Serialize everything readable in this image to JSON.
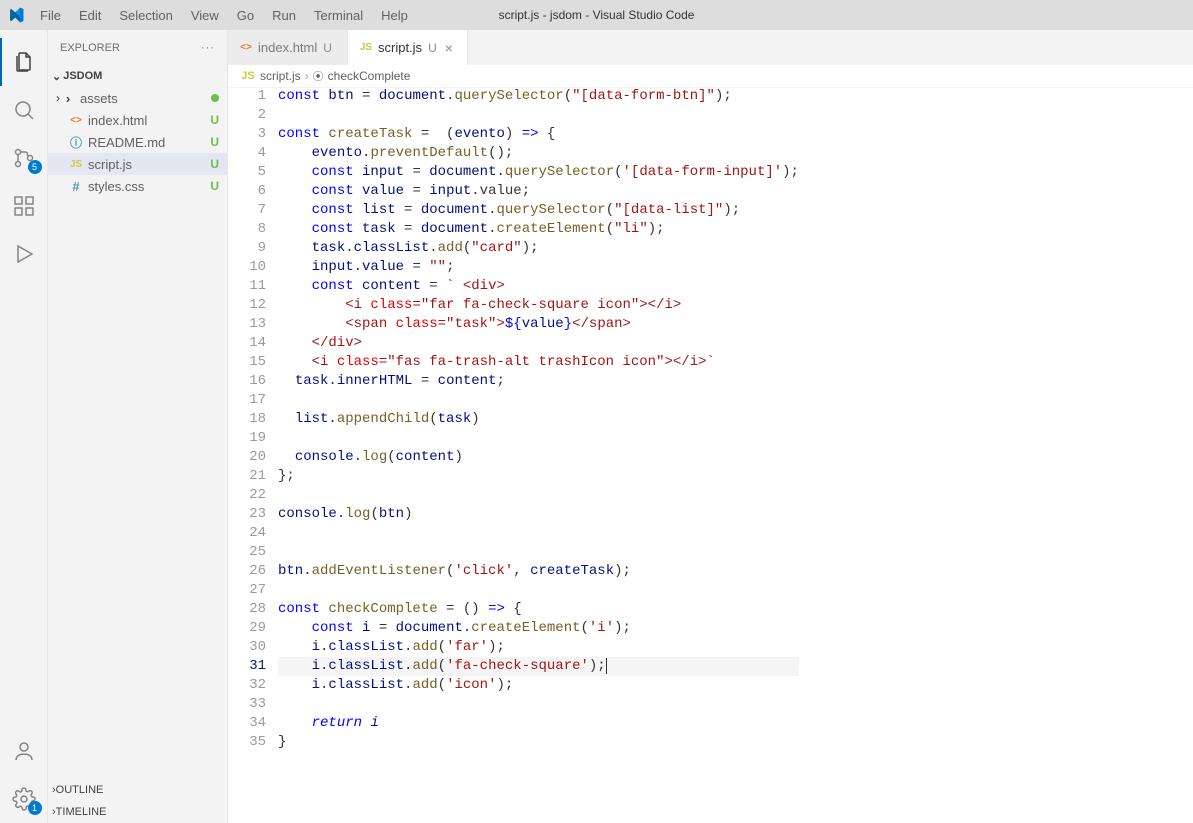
{
  "titlebar": {
    "menus": [
      "File",
      "Edit",
      "Selection",
      "View",
      "Go",
      "Run",
      "Terminal",
      "Help"
    ],
    "title": "script.js - jsdom - Visual Studio Code"
  },
  "activitybar": {
    "scm_badge": "5",
    "settings_badge": "1"
  },
  "sidebar": {
    "title": "EXPLORER",
    "folder": "JSDOM",
    "files": [
      {
        "name": "assets",
        "type": "folder",
        "status": "modified"
      },
      {
        "name": "index.html",
        "type": "html",
        "status": "U"
      },
      {
        "name": "README.md",
        "type": "md",
        "status": "U"
      },
      {
        "name": "script.js",
        "type": "js",
        "status": "U",
        "selected": true
      },
      {
        "name": "styles.css",
        "type": "css",
        "status": "U"
      }
    ],
    "outline": "OUTLINE",
    "timeline": "TIMELINE"
  },
  "tabs": [
    {
      "label": "index.html",
      "type": "html",
      "mod": "U",
      "active": false
    },
    {
      "label": "script.js",
      "type": "js",
      "mod": "U",
      "active": true
    }
  ],
  "breadcrumbs": {
    "file_icon": "JS",
    "file": "script.js",
    "sym_icon": "⊕",
    "symbol": "checkComplete"
  },
  "code": {
    "current_line": 31,
    "lines": [
      {
        "n": 1,
        "tokens": [
          [
            "kw",
            "const"
          ],
          [
            "",
            " "
          ],
          [
            "var",
            "btn"
          ],
          [
            "",
            " "
          ],
          [
            "",
            "="
          ],
          [
            "",
            " "
          ],
          [
            "obj",
            "document"
          ],
          [
            "",
            "."
          ],
          [
            "fn",
            "querySelector"
          ],
          [
            "",
            "("
          ],
          [
            "str",
            "\"[data-form-btn]\""
          ],
          [
            "",
            ");"
          ]
        ]
      },
      {
        "n": 2,
        "tokens": []
      },
      {
        "n": 3,
        "tokens": [
          [
            "kw",
            "const"
          ],
          [
            "",
            " "
          ],
          [
            "fn",
            "createTask"
          ],
          [
            "",
            " "
          ],
          [
            "",
            "="
          ],
          [
            "",
            "  ("
          ],
          [
            "var",
            "evento"
          ],
          [
            "",
            ")"
          ],
          [
            "",
            " "
          ],
          [
            "kw",
            "=>"
          ],
          [
            "",
            " {"
          ]
        ]
      },
      {
        "n": 4,
        "tokens": [
          [
            "",
            "    "
          ],
          [
            "obj",
            "evento"
          ],
          [
            "",
            "."
          ],
          [
            "fn",
            "preventDefault"
          ],
          [
            "",
            "();"
          ]
        ]
      },
      {
        "n": 5,
        "tokens": [
          [
            "",
            "    "
          ],
          [
            "kw",
            "const"
          ],
          [
            "",
            " "
          ],
          [
            "var",
            "input"
          ],
          [
            "",
            " = "
          ],
          [
            "obj",
            "document"
          ],
          [
            "",
            "."
          ],
          [
            "fn",
            "querySelector"
          ],
          [
            "",
            "("
          ],
          [
            "str",
            "'[data-form-input]'"
          ],
          [
            "",
            ");"
          ]
        ]
      },
      {
        "n": 6,
        "tokens": [
          [
            "",
            "    "
          ],
          [
            "kw",
            "const"
          ],
          [
            "",
            " "
          ],
          [
            "var",
            "value"
          ],
          [
            "",
            " = "
          ],
          [
            "obj",
            "input"
          ],
          [
            "",
            ".value;"
          ]
        ]
      },
      {
        "n": 7,
        "tokens": [
          [
            "",
            "    "
          ],
          [
            "kw",
            "const"
          ],
          [
            "",
            " "
          ],
          [
            "var",
            "list"
          ],
          [
            "",
            " = "
          ],
          [
            "obj",
            "document"
          ],
          [
            "",
            "."
          ],
          [
            "fn",
            "querySelector"
          ],
          [
            "",
            "("
          ],
          [
            "str",
            "\"[data-list]\""
          ],
          [
            "",
            ");"
          ]
        ]
      },
      {
        "n": 8,
        "tokens": [
          [
            "",
            "    "
          ],
          [
            "kw",
            "const"
          ],
          [
            "",
            " "
          ],
          [
            "var",
            "task"
          ],
          [
            "",
            " = "
          ],
          [
            "obj",
            "document"
          ],
          [
            "",
            "."
          ],
          [
            "fn",
            "createElement"
          ],
          [
            "",
            "("
          ],
          [
            "str",
            "\"li\""
          ],
          [
            "",
            ");"
          ]
        ]
      },
      {
        "n": 9,
        "tokens": [
          [
            "",
            "    "
          ],
          [
            "obj",
            "task"
          ],
          [
            "",
            "."
          ],
          [
            "obj",
            "classList"
          ],
          [
            "",
            "."
          ],
          [
            "fn",
            "add"
          ],
          [
            "",
            "("
          ],
          [
            "str",
            "\"card\""
          ],
          [
            "",
            ");"
          ]
        ]
      },
      {
        "n": 10,
        "tokens": [
          [
            "",
            "    "
          ],
          [
            "obj",
            "input"
          ],
          [
            "",
            "."
          ],
          [
            "obj",
            "value"
          ],
          [
            "",
            " = "
          ],
          [
            "str",
            "\"\""
          ],
          [
            "",
            ";"
          ]
        ]
      },
      {
        "n": 11,
        "tokens": [
          [
            "",
            "    "
          ],
          [
            "kw",
            "const"
          ],
          [
            "",
            " "
          ],
          [
            "var",
            "content"
          ],
          [
            "",
            " = "
          ],
          [
            "templ",
            "` <div>"
          ]
        ]
      },
      {
        "n": 12,
        "tokens": [
          [
            "templ",
            "        <i "
          ],
          [
            "attr",
            "class"
          ],
          [
            "templ",
            "="
          ],
          [
            "str",
            "\"far fa-check-square icon\""
          ],
          [
            "templ",
            "></i>"
          ]
        ]
      },
      {
        "n": 13,
        "tokens": [
          [
            "templ",
            "        <span "
          ],
          [
            "attr",
            "class"
          ],
          [
            "templ",
            "="
          ],
          [
            "str",
            "\"task\""
          ],
          [
            "templ",
            ">"
          ],
          [
            "kw",
            "${"
          ],
          [
            "var",
            "value"
          ],
          [
            "kw",
            "}"
          ],
          [
            "templ",
            "</span>"
          ]
        ]
      },
      {
        "n": 14,
        "tokens": [
          [
            "templ",
            "    </div>"
          ]
        ]
      },
      {
        "n": 15,
        "tokens": [
          [
            "templ",
            "    <i "
          ],
          [
            "attr",
            "class"
          ],
          [
            "templ",
            "="
          ],
          [
            "str",
            "\"fas fa-trash-alt trashIcon icon\""
          ],
          [
            "templ",
            "></i>`"
          ]
        ]
      },
      {
        "n": 16,
        "tokens": [
          [
            "",
            "  "
          ],
          [
            "obj",
            "task"
          ],
          [
            "",
            "."
          ],
          [
            "obj",
            "innerHTML"
          ],
          [
            "",
            " = "
          ],
          [
            "var",
            "content"
          ],
          [
            "",
            ";"
          ]
        ]
      },
      {
        "n": 17,
        "tokens": []
      },
      {
        "n": 18,
        "tokens": [
          [
            "",
            "  "
          ],
          [
            "obj",
            "list"
          ],
          [
            "",
            "."
          ],
          [
            "fn",
            "appendChild"
          ],
          [
            "",
            "("
          ],
          [
            "var",
            "task"
          ],
          [
            "",
            ")"
          ]
        ]
      },
      {
        "n": 19,
        "tokens": []
      },
      {
        "n": 20,
        "tokens": [
          [
            "",
            "  "
          ],
          [
            "obj",
            "console"
          ],
          [
            "",
            "."
          ],
          [
            "fn",
            "log"
          ],
          [
            "",
            "("
          ],
          [
            "var",
            "content"
          ],
          [
            "",
            ")"
          ]
        ]
      },
      {
        "n": 21,
        "tokens": [
          [
            "",
            "};"
          ]
        ]
      },
      {
        "n": 22,
        "tokens": []
      },
      {
        "n": 23,
        "tokens": [
          [
            "obj",
            "console"
          ],
          [
            "",
            "."
          ],
          [
            "fn",
            "log"
          ],
          [
            "",
            "("
          ],
          [
            "var",
            "btn"
          ],
          [
            "",
            ")"
          ]
        ]
      },
      {
        "n": 24,
        "tokens": []
      },
      {
        "n": 25,
        "tokens": []
      },
      {
        "n": 26,
        "tokens": [
          [
            "obj",
            "btn"
          ],
          [
            "",
            "."
          ],
          [
            "fn",
            "addEventListener"
          ],
          [
            "",
            "("
          ],
          [
            "str",
            "'click'"
          ],
          [
            "",
            ", "
          ],
          [
            "var",
            "createTask"
          ],
          [
            "",
            ");"
          ]
        ]
      },
      {
        "n": 27,
        "tokens": []
      },
      {
        "n": 28,
        "tokens": [
          [
            "kw",
            "const"
          ],
          [
            "",
            " "
          ],
          [
            "fn",
            "checkComplete"
          ],
          [
            "",
            " = () "
          ],
          [
            "kw",
            "=>"
          ],
          [
            "",
            " {"
          ]
        ]
      },
      {
        "n": 29,
        "tokens": [
          [
            "",
            "    "
          ],
          [
            "kw",
            "const"
          ],
          [
            "",
            " "
          ],
          [
            "var",
            "i"
          ],
          [
            "",
            " = "
          ],
          [
            "obj",
            "document"
          ],
          [
            "",
            "."
          ],
          [
            "fn",
            "createElement"
          ],
          [
            "",
            "("
          ],
          [
            "str",
            "'i'"
          ],
          [
            "",
            ");"
          ]
        ]
      },
      {
        "n": 30,
        "tokens": [
          [
            "",
            "    "
          ],
          [
            "obj",
            "i"
          ],
          [
            "",
            "."
          ],
          [
            "obj",
            "classList"
          ],
          [
            "",
            "."
          ],
          [
            "fn",
            "add"
          ],
          [
            "",
            "("
          ],
          [
            "str",
            "'far'"
          ],
          [
            "",
            ");"
          ]
        ]
      },
      {
        "n": 31,
        "tokens": [
          [
            "",
            "    "
          ],
          [
            "obj",
            "i"
          ],
          [
            "",
            "."
          ],
          [
            "obj",
            "classList"
          ],
          [
            "",
            "."
          ],
          [
            "fn",
            "add"
          ],
          [
            "",
            "("
          ],
          [
            "str",
            "'fa-check-square'"
          ],
          [
            "",
            ");"
          ]
        ]
      },
      {
        "n": 32,
        "tokens": [
          [
            "",
            "    "
          ],
          [
            "obj",
            "i"
          ],
          [
            "",
            "."
          ],
          [
            "obj",
            "classList"
          ],
          [
            "",
            "."
          ],
          [
            "fn",
            "add"
          ],
          [
            "",
            "("
          ],
          [
            "str",
            "'icon'"
          ],
          [
            "",
            ");"
          ]
        ]
      },
      {
        "n": 33,
        "tokens": []
      },
      {
        "n": 34,
        "tokens": [
          [
            "",
            "    "
          ],
          [
            "kw it",
            "return"
          ],
          [
            "",
            " "
          ],
          [
            "var it",
            "i"
          ]
        ]
      },
      {
        "n": 35,
        "tokens": [
          [
            "",
            "}"
          ]
        ]
      }
    ]
  }
}
